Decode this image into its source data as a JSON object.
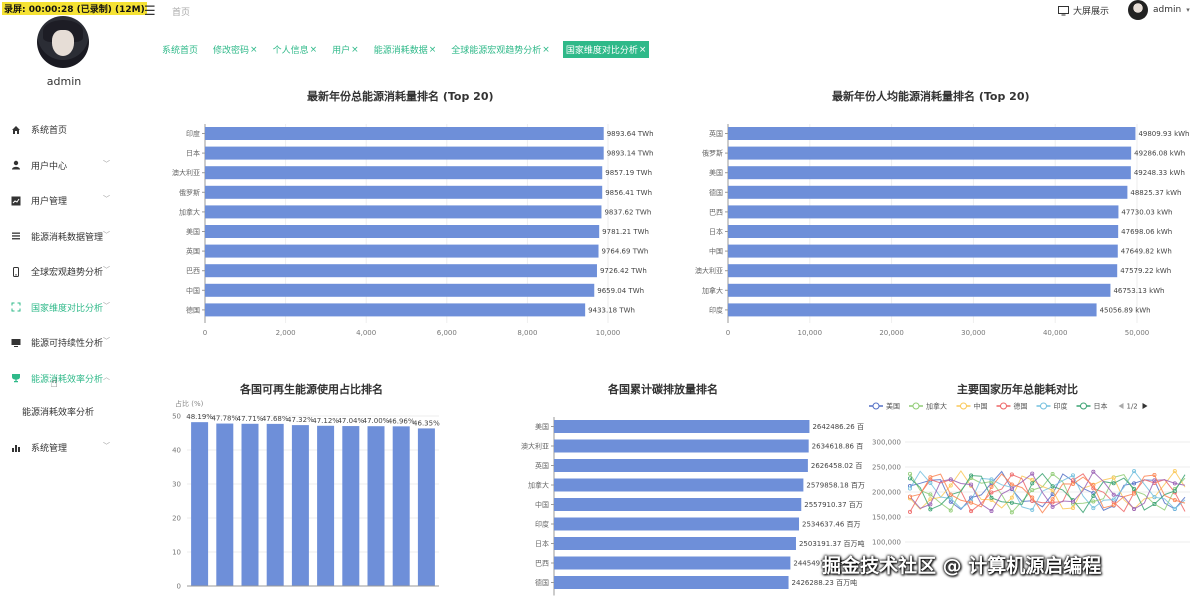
{
  "recording_badge": "录屏: 00:00:28 (已录制) (12M)",
  "sidebar": {
    "username": "admin",
    "items": [
      {
        "label": "系统首页",
        "icon": "home-icon",
        "expandable": false
      },
      {
        "label": "用户中心",
        "icon": "user-icon",
        "expandable": true
      },
      {
        "label": "用户管理",
        "icon": "chart-line-icon",
        "expandable": true
      },
      {
        "label": "能源消耗数据管理",
        "icon": "list-icon",
        "expandable": true
      },
      {
        "label": "全球宏观趋势分析",
        "icon": "phone-icon",
        "expandable": true
      },
      {
        "label": "国家维度对比分析",
        "icon": "fullscreen-icon",
        "expandable": true,
        "active": true
      },
      {
        "label": "能源可持续性分析",
        "icon": "monitor-icon",
        "expandable": true
      },
      {
        "label": "能源消耗效率分析",
        "icon": "cup-icon",
        "expandable": true,
        "active": true,
        "open": true
      }
    ],
    "sub_items": [
      "能源消耗效率分析"
    ],
    "last_item": {
      "label": "系统管理",
      "icon": "bar-chart-icon",
      "expandable": true
    }
  },
  "header": {
    "breadcrumb": "首页",
    "screen_button": "大屏展示",
    "user": "admin"
  },
  "tags": [
    {
      "label": "系统首页",
      "closable": false
    },
    {
      "label": "修改密码",
      "closable": true
    },
    {
      "label": "个人信息",
      "closable": true
    },
    {
      "label": "用户",
      "closable": true
    },
    {
      "label": "能源消耗数据",
      "closable": true
    },
    {
      "label": "全球能源宏观趋势分析",
      "closable": true
    },
    {
      "label": "国家维度对比分析",
      "closable": true,
      "active": true
    }
  ],
  "colors": {
    "accent": "#2fb989",
    "bar": "#6e8fd9"
  },
  "chart_data": [
    {
      "type": "bar",
      "orientation": "horizontal",
      "title": "最新年份总能源消耗量排名 (Top 20)",
      "categories": [
        "印度",
        "日本",
        "澳大利亚",
        "俄罗斯",
        "加拿大",
        "美国",
        "英国",
        "巴西",
        "中国",
        "德国"
      ],
      "values": [
        9893.64,
        9893.14,
        9857.19,
        9856.41,
        9837.62,
        9781.21,
        9764.69,
        9726.42,
        9659.04,
        9433.18
      ],
      "labels": [
        "9893.64 TWh",
        "9893.14 TWh",
        "9857.19 TWh",
        "9856.41 TWh",
        "9837.62 TWh",
        "9781.21 TWh",
        "9764.69 TWh",
        "9726.42 TWh",
        "9659.04 TWh",
        "9433.18 TWh"
      ],
      "xticks": [
        "0",
        "2,000",
        "4,000",
        "6,000",
        "8,000",
        "10,000"
      ],
      "xlim": [
        0,
        10000
      ]
    },
    {
      "type": "bar",
      "orientation": "horizontal",
      "title": "最新年份人均能源消耗量排名 (Top 20)",
      "categories": [
        "英国",
        "俄罗斯",
        "美国",
        "德国",
        "巴西",
        "日本",
        "中国",
        "澳大利亚",
        "加拿大",
        "印度"
      ],
      "values": [
        49809.93,
        49286.08,
        49248.33,
        48825.37,
        47730.03,
        47698.06,
        47649.82,
        47579.22,
        46753.13,
        45056.89
      ],
      "labels": [
        "49809.93 kWh",
        "49286.08 kWh",
        "49248.33 kWh",
        "48825.37 kWh",
        "47730.03 kWh",
        "47698.06 kWh",
        "47649.82 kWh",
        "47579.22 kWh",
        "46753.13 kWh",
        "45056.89 kWh"
      ],
      "xticks": [
        "0",
        "10,000",
        "20,000",
        "30,000",
        "40,000",
        "50,000"
      ],
      "xlim": [
        0,
        50000
      ]
    },
    {
      "type": "bar",
      "orientation": "vertical",
      "title": "各国可再生能源使用占比排名",
      "ylabel": "占比 (%)",
      "values": [
        48.19,
        47.78,
        47.71,
        47.68,
        47.32,
        47.12,
        47.04,
        47.0,
        46.96,
        46.35
      ],
      "labels": [
        "48.19%",
        "47.78%",
        "47.71%",
        "47.68%",
        "47.32%",
        "47.12%",
        "47.04%",
        "47.00%",
        "46.96%",
        "46.35%"
      ],
      "yticks": [
        "0",
        "10",
        "20",
        "30",
        "40",
        "50"
      ],
      "ylim": [
        0,
        50
      ]
    },
    {
      "type": "bar",
      "orientation": "horizontal",
      "title": "各国累计碳排放量排名",
      "categories": [
        "美国",
        "澳大利亚",
        "英国",
        "加拿大",
        "中国",
        "印度",
        "日本",
        "巴西",
        "德国"
      ],
      "values": [
        2642486.26,
        2634618.86,
        2626458.02,
        2579858.18,
        2557910.37,
        2534637.46,
        2503191.37,
        2445497.95,
        2426288.23
      ],
      "labels": [
        "2642486.26 百",
        "2634618.86 百",
        "2626458.02 百",
        "2579858.18 百万",
        "2557910.37 百万",
        "2534637.46 百万",
        "2503191.37 百万吨",
        "2445497.95 百万吨",
        "2426288.23 百万吨"
      ],
      "xlim": [
        0,
        2700000
      ]
    },
    {
      "type": "line",
      "title": "主要国家历年总能耗对比",
      "legend": [
        "美国",
        "加拿大",
        "中国",
        "德国",
        "印度",
        "日本"
      ],
      "legend_page": "1/2",
      "yticks": [
        "100,000",
        "150,000",
        "200,000",
        "250,000",
        "300,000"
      ],
      "ylim": [
        100000,
        300000
      ]
    }
  ],
  "watermark": "掘金技术社区 @ 计算机源启编程"
}
